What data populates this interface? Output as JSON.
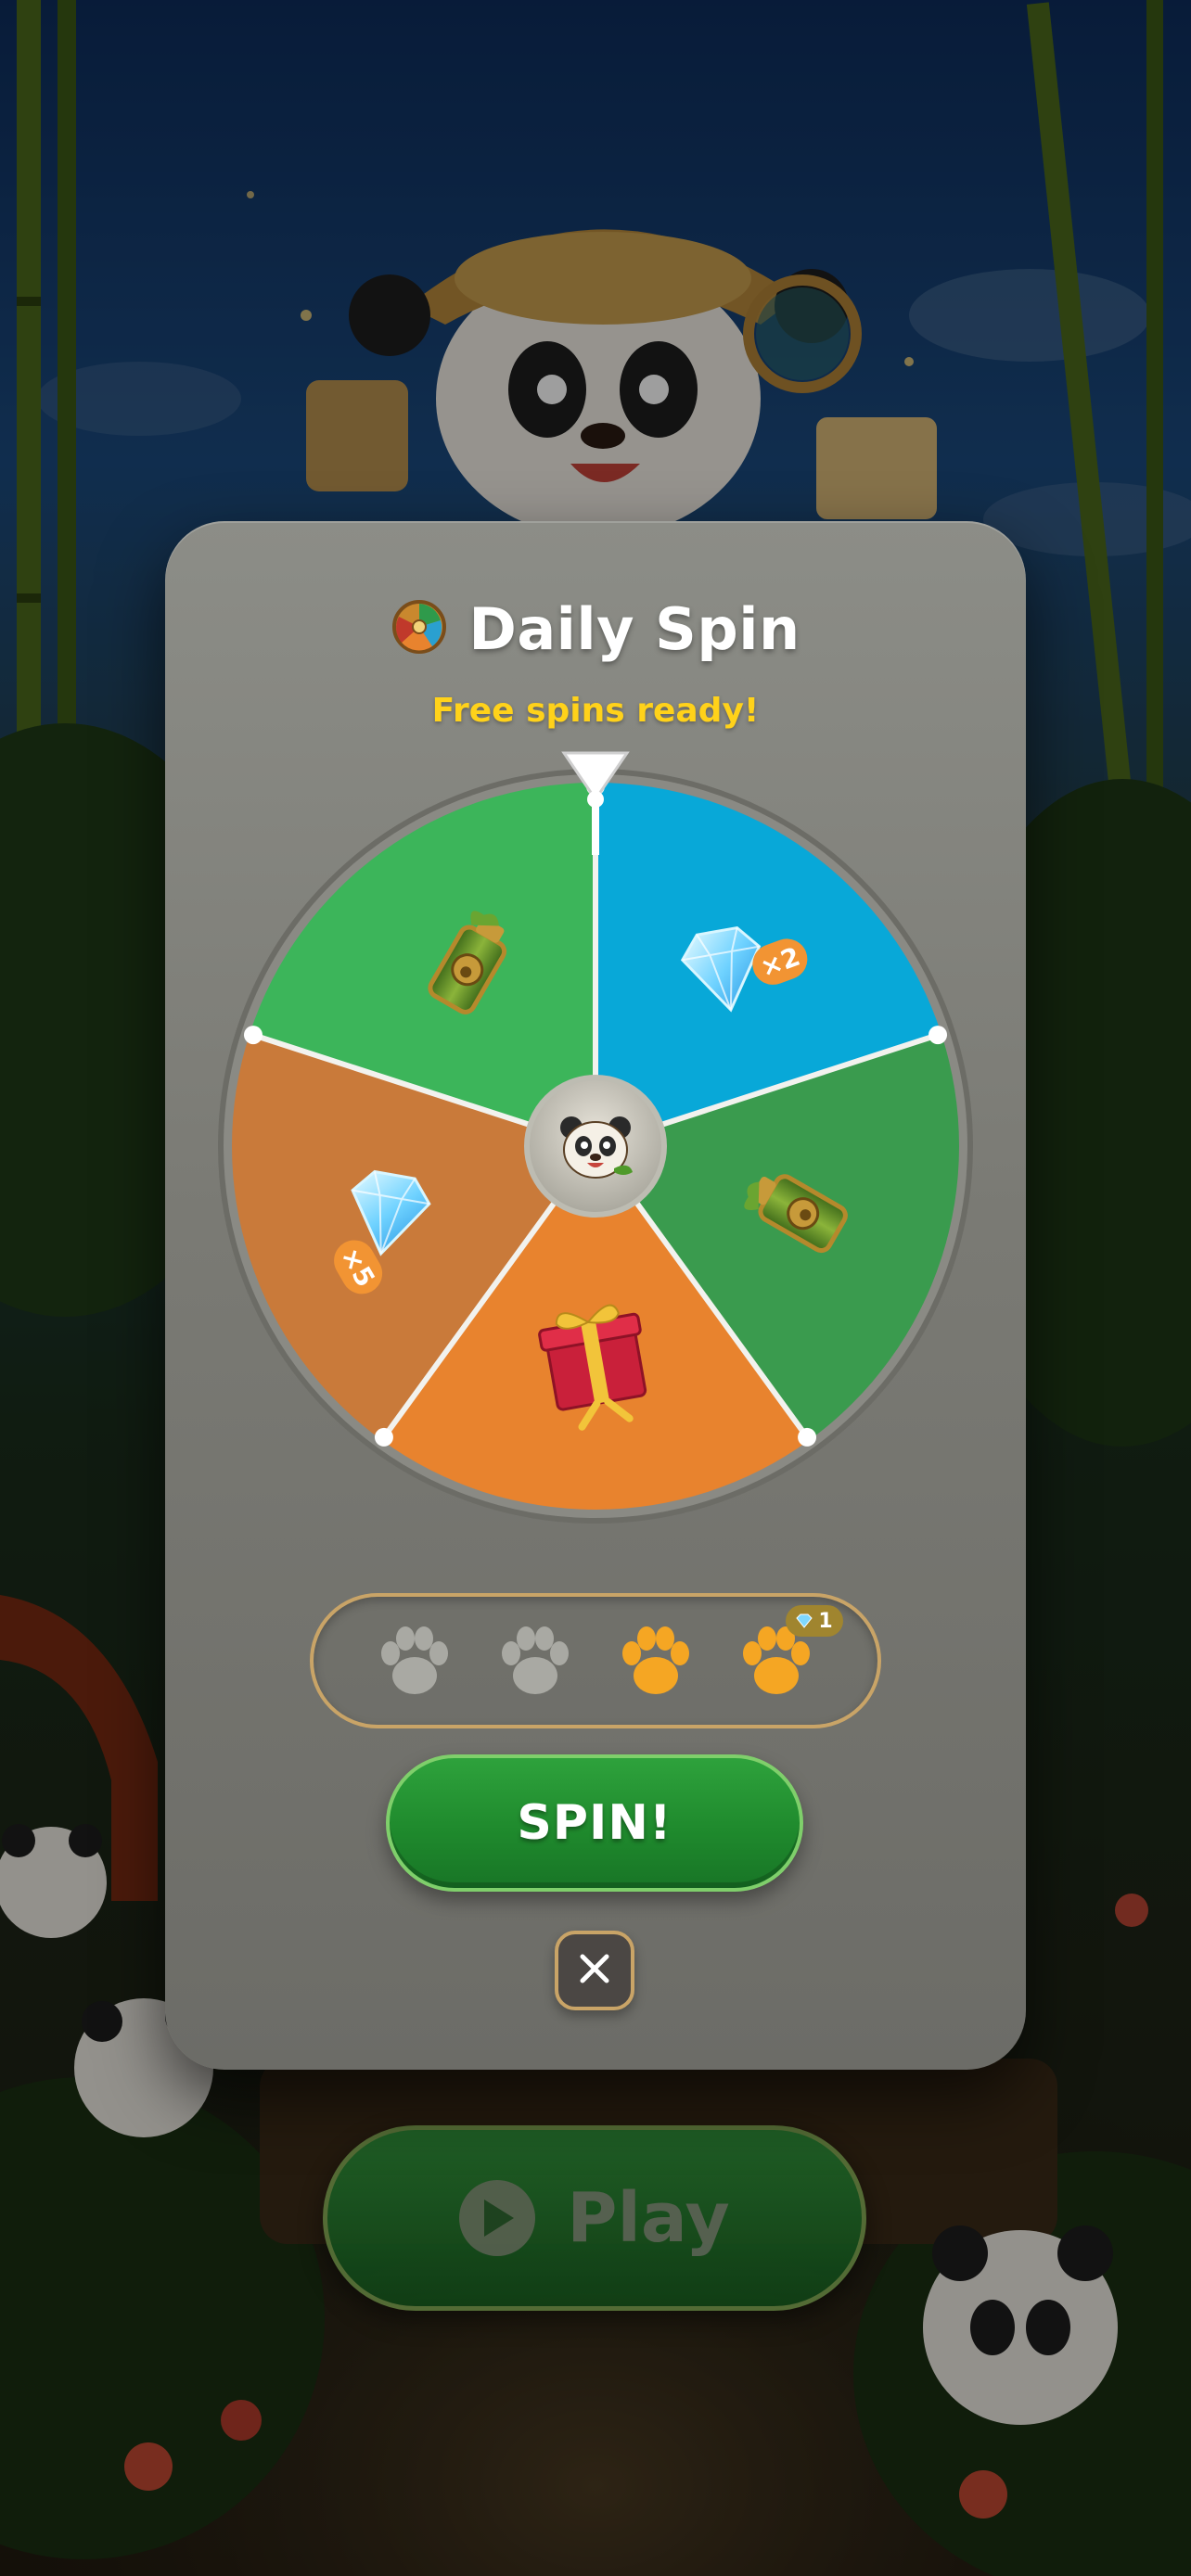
{
  "modal": {
    "title": "Daily Spin",
    "subtitle": "Free spins ready!",
    "spin_label": "SPIN!",
    "close_icon": "close-icon"
  },
  "wheel": {
    "segments": [
      {
        "reward": "gem",
        "badge": "×2",
        "color": "#08a8d8"
      },
      {
        "reward": "booster-canister",
        "badge": "",
        "color": "#3a9b4e"
      },
      {
        "reward": "gift-box",
        "badge": "",
        "color": "#e8832e"
      },
      {
        "reward": "gem",
        "badge": "×5",
        "color": "#c97a3a"
      },
      {
        "reward": "booster-canister",
        "badge": "",
        "color": "#3cb55a"
      }
    ],
    "hub_icon": "panda-icon"
  },
  "spin_progress": {
    "total": 4,
    "filled": 2,
    "bonus_badge": "1",
    "bonus_icon": "gem-icon"
  },
  "play_button": {
    "label": "Play",
    "icon": "play-icon"
  },
  "colors": {
    "accent_gold": "#ffd21a",
    "spin_green": "#1f8a2d",
    "badge_orange": "#f29433",
    "paw_active": "#f5a623",
    "paw_inactive": "#a9a9a3"
  }
}
